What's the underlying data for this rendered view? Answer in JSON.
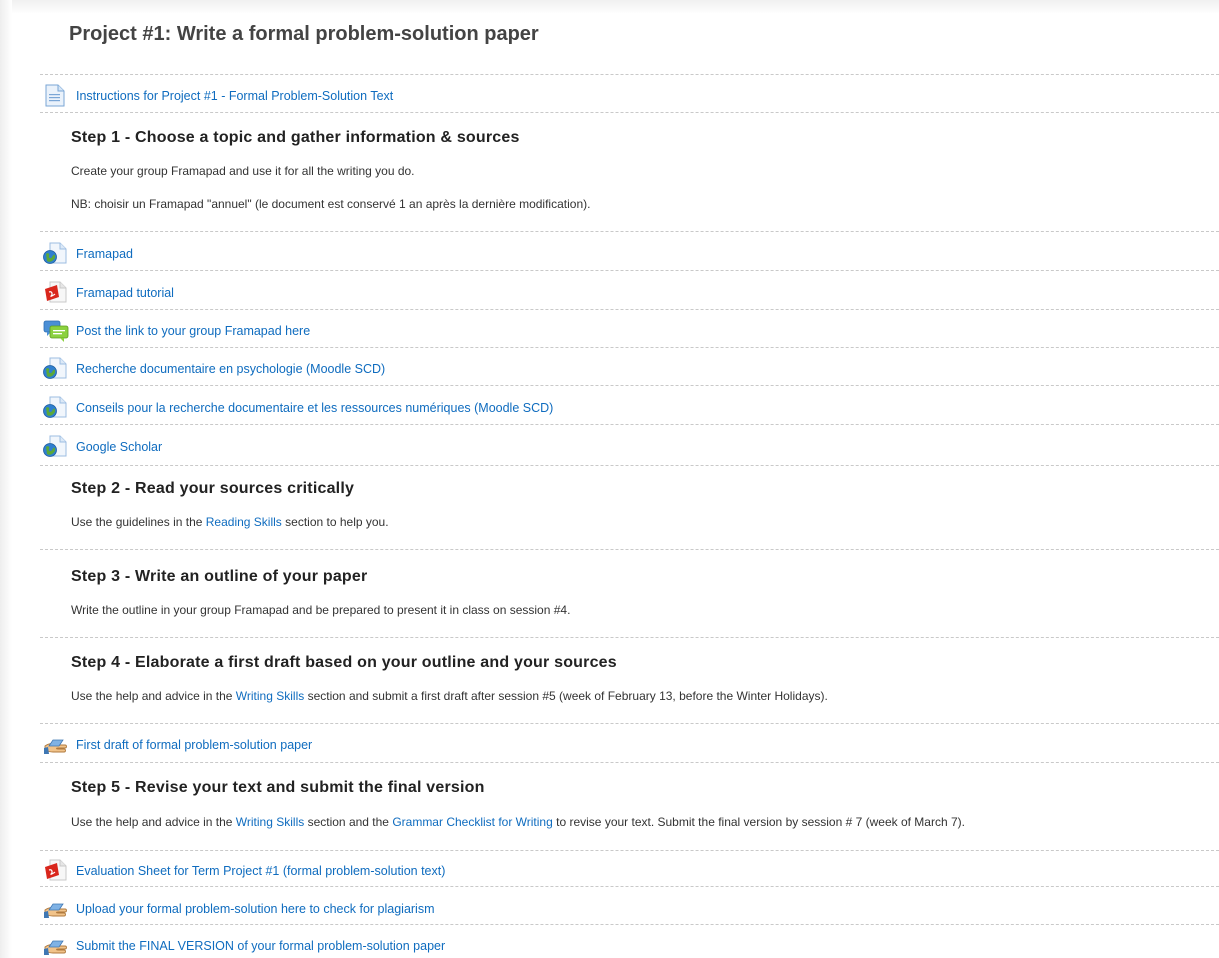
{
  "section": {
    "title": "Project #1: Write a formal problem-solution paper"
  },
  "activities": {
    "instructions": {
      "label": "Instructions for Project #1 - Formal Problem-Solution Text",
      "icon": "page-icon"
    },
    "framapad": {
      "label": "Framapad",
      "icon": "url-icon"
    },
    "framapad_tutorial": {
      "label": "Framapad tutorial",
      "icon": "pdf-icon"
    },
    "post_link": {
      "label": "Post the link to your group Framapad here",
      "icon": "forum-icon"
    },
    "recherche_psy": {
      "label": "Recherche documentaire en psychologie (Moodle SCD)",
      "icon": "url-icon"
    },
    "conseils": {
      "label": "Conseils pour la recherche documentaire et les ressources numériques (Moodle SCD)",
      "icon": "url-icon"
    },
    "google_scholar": {
      "label": "Google Scholar",
      "icon": "url-icon"
    },
    "first_draft": {
      "label": "First draft of formal problem-solution paper",
      "icon": "assignment-icon"
    },
    "evaluation_sheet": {
      "label": "Evaluation Sheet for Term Project #1 (formal problem-solution text)",
      "icon": "pdf-icon"
    },
    "upload_plagiarism": {
      "label": "Upload your formal problem-solution here to check for plagiarism",
      "icon": "assignment-icon"
    },
    "submit_final": {
      "label": "Submit the FINAL VERSION of your formal problem-solution paper",
      "icon": "assignment-icon"
    }
  },
  "step1": {
    "heading": "Step 1 - Choose a topic and gather information & sources",
    "line1": "Create your group Framapad and use it for all the writing you do.",
    "line2": "NB: choisir un Framapad \"annuel\" (le document est conservé 1 an après la dernière modification)."
  },
  "step2": {
    "heading": "Step 2 - Read your sources critically",
    "text_before": "Use the guidelines in the ",
    "link": "Reading Skills",
    "text_after": " section to help you."
  },
  "step3": {
    "heading": "Step 3 - Write an outline of your paper",
    "text": "Write the outline in your group Framapad and be prepared to present it in class on session #4."
  },
  "step4": {
    "heading": "Step 4 - Elaborate a first draft based on your outline and your sources",
    "text_before": "Use the help and advice in the ",
    "link": "Writing Skills",
    "text_after": " section and submit a first draft after session #5 (week of February 13, before the Winter Holidays)."
  },
  "step5": {
    "heading": "Step 5 - Revise your text and submit the final version",
    "text_before": "Use the help and advice in the ",
    "link1": "Writing Skills",
    "text_middle": " section and the ",
    "link2": "Grammar Checklist for Writing",
    "text_after": " to revise your text. Submit the final version by session # 7 (week of March 7)."
  },
  "colors": {
    "link": "#0f6cbf",
    "separator": "#c9c9c9",
    "heading": "#222222"
  }
}
